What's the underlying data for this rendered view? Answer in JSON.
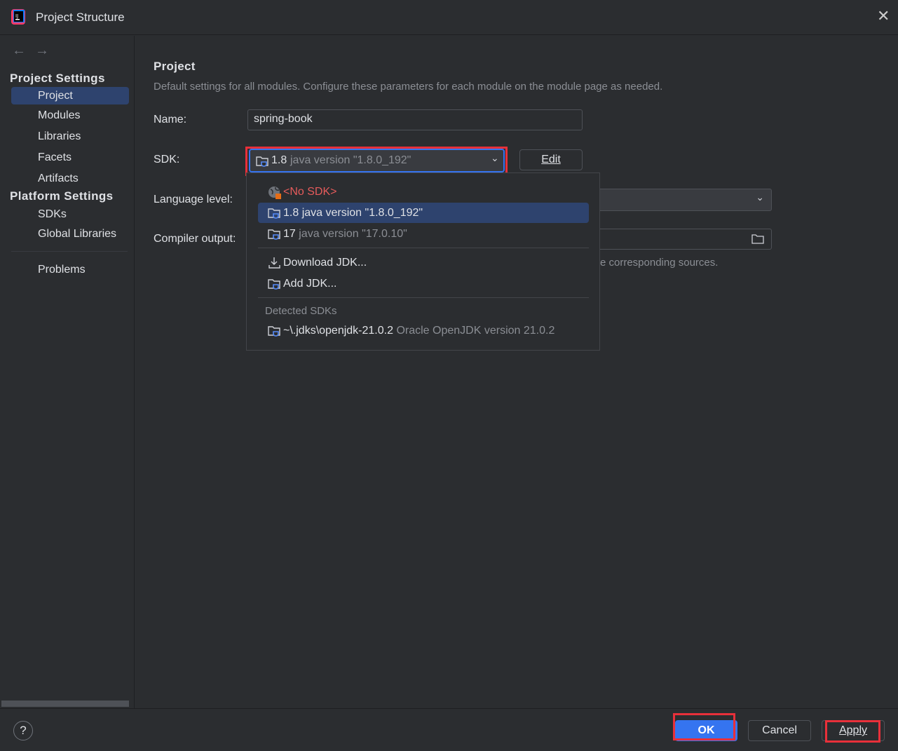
{
  "window": {
    "title": "Project Structure"
  },
  "sidebar": {
    "project_settings_header": "Project Settings",
    "project_items": [
      {
        "label": "Project",
        "selected": true
      },
      {
        "label": "Modules"
      },
      {
        "label": "Libraries"
      },
      {
        "label": "Facets"
      },
      {
        "label": "Artifacts"
      }
    ],
    "platform_settings_header": "Platform Settings",
    "platform_items": [
      {
        "label": "SDKs"
      },
      {
        "label": "Global Libraries"
      }
    ],
    "problems": "Problems"
  },
  "main": {
    "title": "Project",
    "description": "Default settings for all modules. Configure these parameters for each module on the module page as needed.",
    "name_label": "Name:",
    "name_value": "spring-book",
    "sdk_label": "SDK:",
    "sdk_value_version": "1.8",
    "sdk_value_detail": "java version \"1.8.0_192\"",
    "edit_button": "Edit",
    "language_level_label": "Language level:",
    "compiler_output_label": "Compiler output:",
    "compiler_hint_partial": "e corresponding sources."
  },
  "sdk_dropdown": {
    "no_sdk": "<No SDK>",
    "items": [
      {
        "version": "1.8",
        "detail": "java version \"1.8.0_192\"",
        "selected": true
      },
      {
        "version": "17",
        "detail": "java version \"17.0.10\""
      }
    ],
    "download_jdk": "Download JDK...",
    "add_jdk": "Add JDK...",
    "detected_header": "Detected SDKs",
    "detected": [
      {
        "path": "~\\.jdks\\openjdk-21.0.2",
        "detail": "Oracle OpenJDK version 21.0.2"
      }
    ]
  },
  "footer": {
    "help": "?",
    "ok": "OK",
    "cancel": "Cancel",
    "apply": "Apply"
  },
  "colors": {
    "accent": "#3574f0",
    "selection": "#2e436e",
    "highlight_annotation": "#e8303a",
    "error_text": "#e55b5b"
  }
}
